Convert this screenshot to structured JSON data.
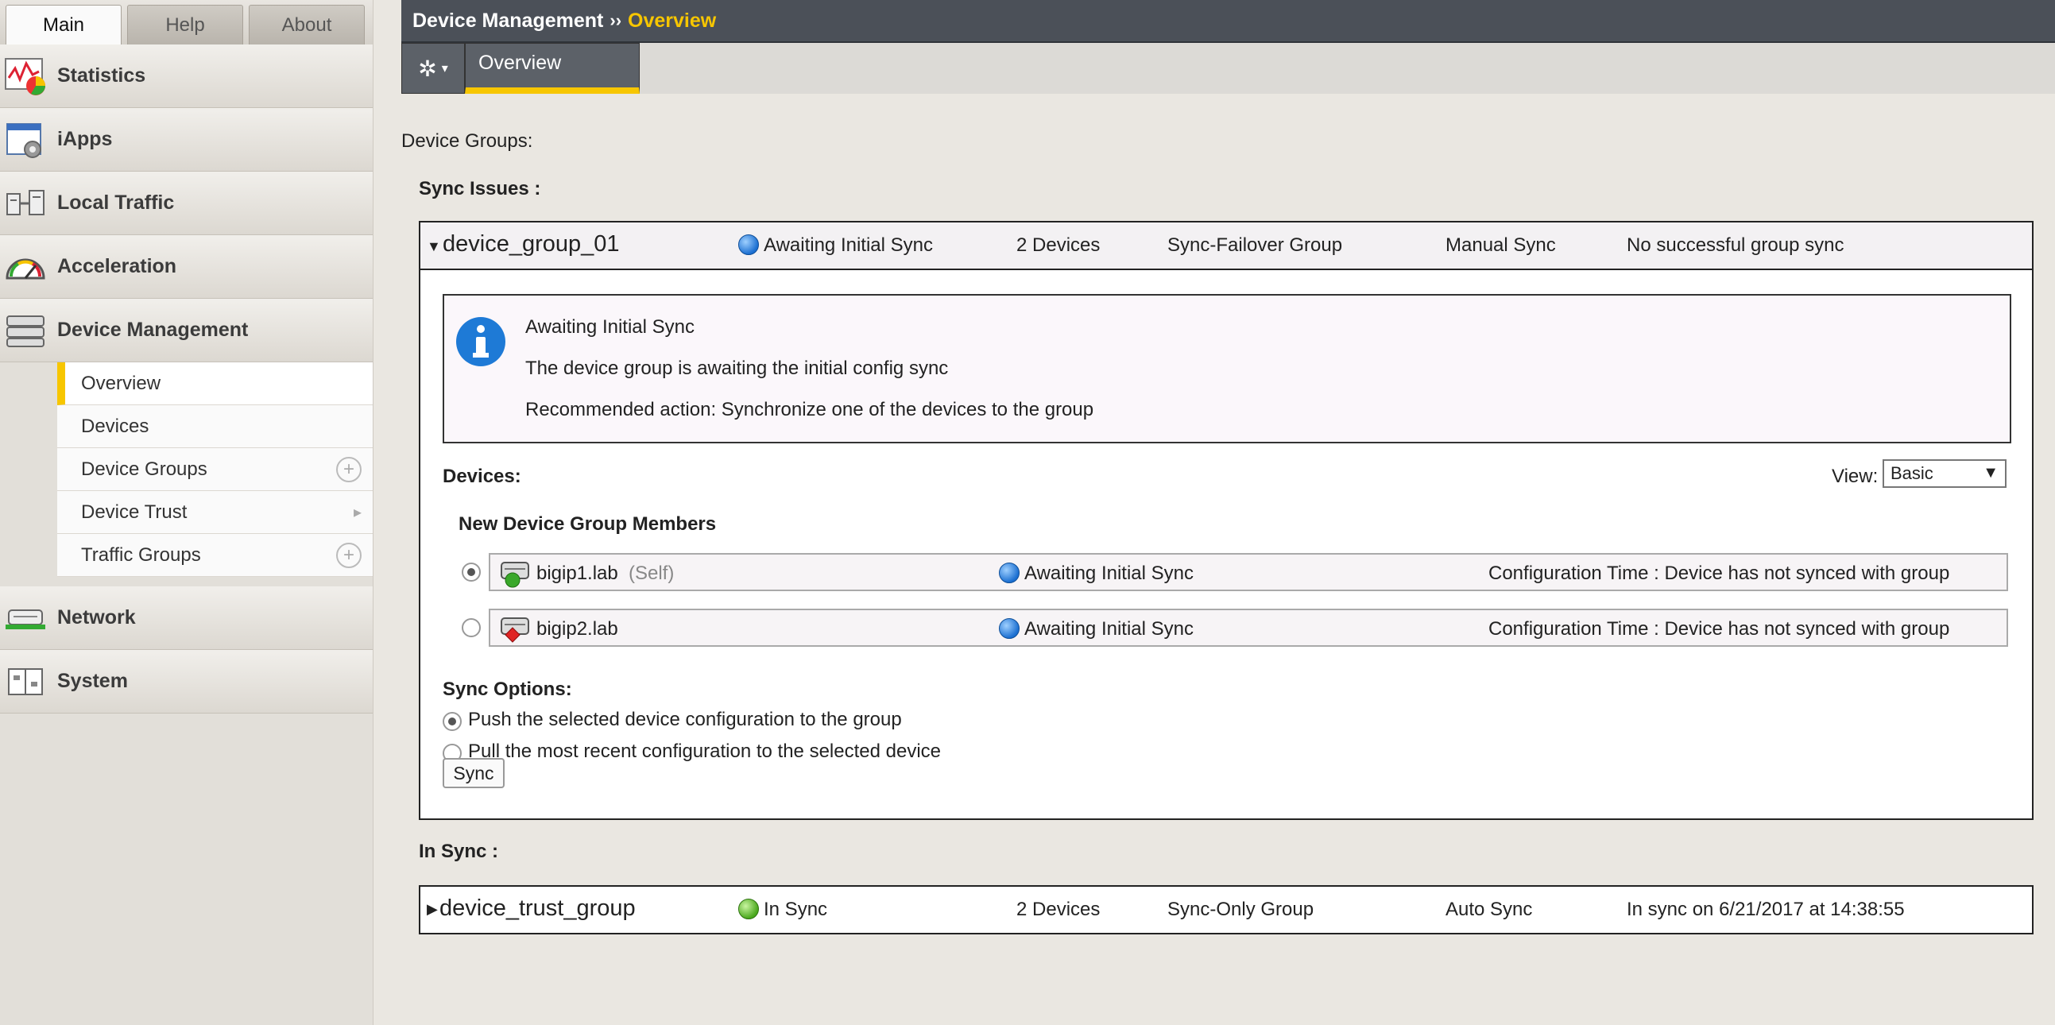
{
  "top_tabs": [
    "Main",
    "Help",
    "About"
  ],
  "sidebar": {
    "sections": [
      {
        "label": "Statistics",
        "icon": "statistics-icon"
      },
      {
        "label": "iApps",
        "icon": "iapps-icon"
      },
      {
        "label": "Local Traffic",
        "icon": "local-traffic-icon"
      },
      {
        "label": "Acceleration",
        "icon": "acceleration-icon"
      },
      {
        "label": "Device Management",
        "icon": "device-management-icon"
      },
      {
        "label": "Network",
        "icon": "network-icon"
      },
      {
        "label": "System",
        "icon": "system-icon"
      }
    ],
    "submenu": [
      "Overview",
      "Devices",
      "Device Groups",
      "Device Trust",
      "Traffic Groups"
    ]
  },
  "header": {
    "crumb1": "Device Management",
    "sep": "››",
    "crumb2": "Overview"
  },
  "toolbar": {
    "tab": "Overview"
  },
  "main": {
    "device_groups_label": "Device Groups:",
    "sync_issues_label": "Sync Issues :",
    "group1": {
      "name": "device_group_01",
      "status": "Awaiting Initial Sync",
      "devices": "2 Devices",
      "type": "Sync-Failover Group",
      "sync_mode": "Manual Sync",
      "last_sync": "No successful group sync"
    },
    "info": {
      "title": "Awaiting Initial Sync",
      "line1": "The device group is awaiting the initial config sync",
      "line2": "Recommended action: Synchronize one of the devices to the group"
    },
    "devices_label": "Devices:",
    "view_label": "View:",
    "view_value": "Basic",
    "new_members_label": "New Device Group Members",
    "members": [
      {
        "name": "bigip1.lab",
        "self": "(Self)",
        "status": "Awaiting Initial Sync",
        "config_time": "Configuration Time : Device has not synced with group"
      },
      {
        "name": "bigip2.lab",
        "self": "",
        "status": "Awaiting Initial Sync",
        "config_time": "Configuration Time : Device has not synced with group"
      }
    ],
    "sync_options_label": "Sync Options:",
    "option_push": "Push the selected device configuration to the group",
    "option_pull": "Pull the most recent configuration to the selected device",
    "sync_button": "Sync",
    "in_sync_label": "In Sync :",
    "group2": {
      "name": "device_trust_group",
      "status": "In Sync",
      "devices": "2 Devices",
      "type": "Sync-Only Group",
      "sync_mode": "Auto Sync",
      "last_sync": "In sync on 6/21/2017 at 14:38:55"
    }
  }
}
